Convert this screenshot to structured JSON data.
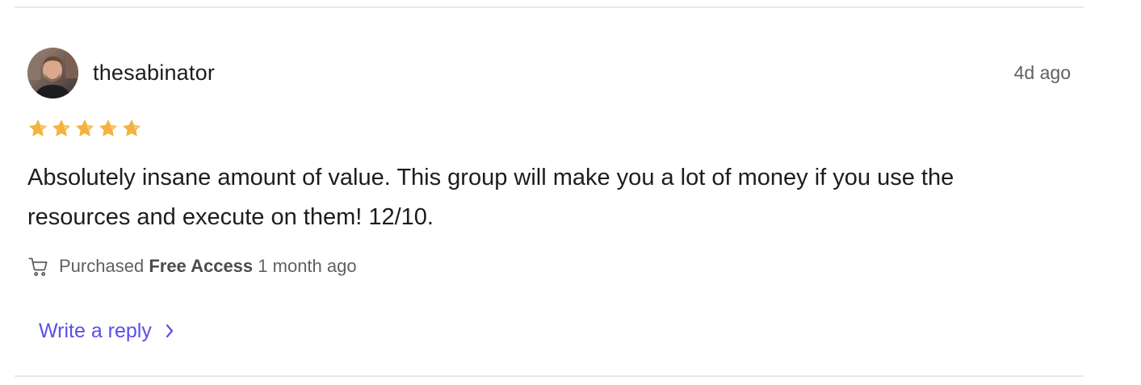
{
  "review": {
    "username": "thesabinator",
    "timestamp": "4d ago",
    "rating": 5,
    "rating_max": 5,
    "star_color": "#F4B33E",
    "body": "Absolutely insane amount of value. This group will make you a lot of money if you use the resources and execute on them! 12/10.",
    "purchase": {
      "icon": "cart-icon",
      "prefix": "Purchased",
      "product": "Free Access",
      "when": "1 month ago"
    },
    "reply": {
      "label": "Write a reply",
      "icon": "chevron-right-icon",
      "color": "#5B4EE8"
    }
  }
}
